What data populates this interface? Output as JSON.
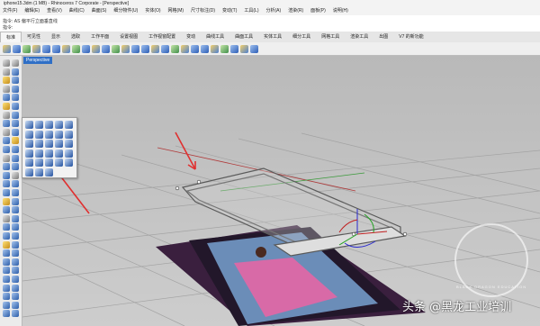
{
  "window": {
    "title": "iphone15.3dm (1 MB) - Rhinoceros 7 Corporate - [Perspective]"
  },
  "menu": [
    "文件(F)",
    "编辑(E)",
    "查看(V)",
    "曲线(C)",
    "曲面(S)",
    "细分物件(U)",
    "实体(O)",
    "网格(M)",
    "尺寸标注(D)",
    "变动(T)",
    "工具(L)",
    "分析(A)",
    "渲染(R)",
    "面板(P)",
    "说明(H)"
  ],
  "command": {
    "history": "指令: AS 偏平行立面垂直线",
    "prompt": "指令:"
  },
  "toolbar_tabs": [
    "标准",
    "可见性",
    "显示",
    "选取",
    "工作平面",
    "设置视图",
    "工作视窗配置",
    "变动",
    "曲线工具",
    "曲面工具",
    "实体工具",
    "细分工具",
    "网格工具",
    "渲染工具",
    "出图",
    "V7 的新功能"
  ],
  "viewport": {
    "label": "Perspective"
  },
  "overlay": {
    "watermark": "头条 @黑龙工业培训",
    "logo_text": "BLACK DRAGON EDUCATION"
  },
  "icons": {
    "toolbar": "rhino-toolbar-icon",
    "side": "rhino-tool-icon"
  }
}
